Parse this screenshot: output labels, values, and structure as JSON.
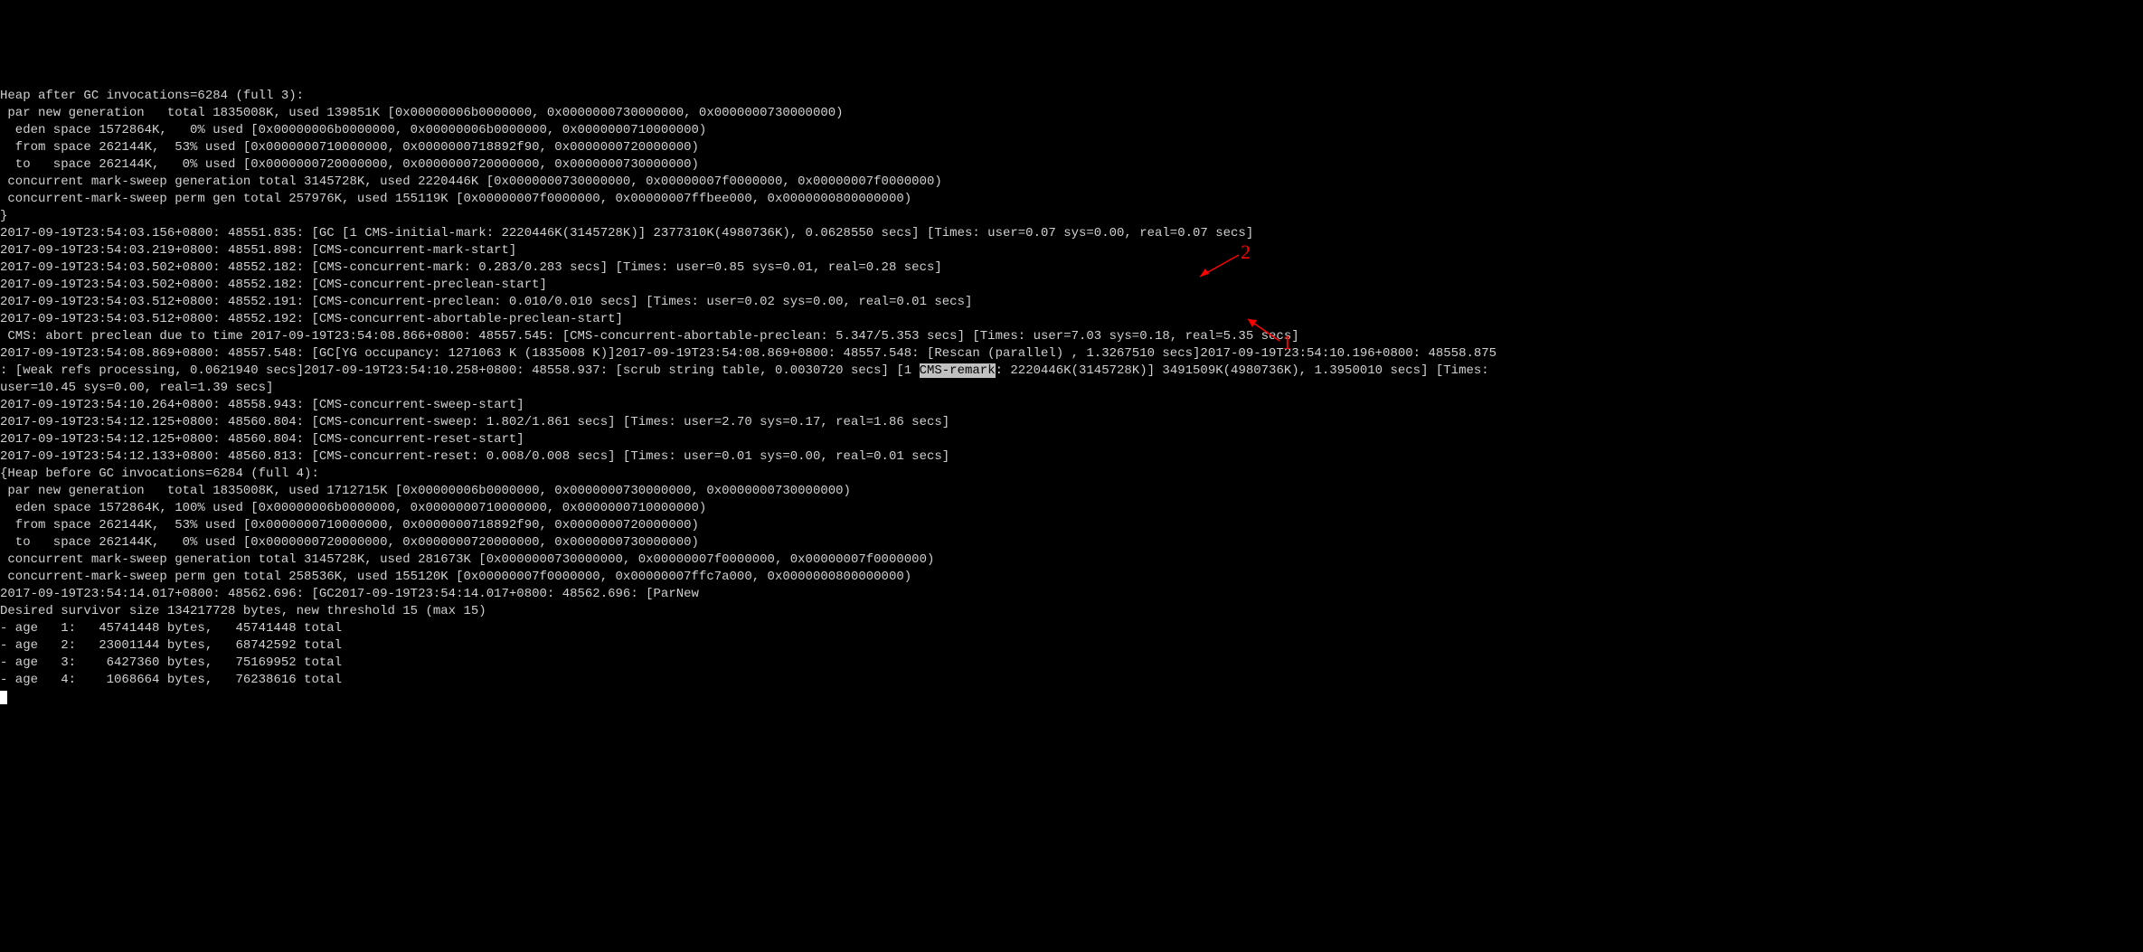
{
  "lines": [
    "Heap after GC invocations=6284 (full 3):",
    " par new generation   total 1835008K, used 139851K [0x00000006b0000000, 0x0000000730000000, 0x0000000730000000)",
    "  eden space 1572864K,   0% used [0x00000006b0000000, 0x00000006b0000000, 0x0000000710000000)",
    "  from space 262144K,  53% used [0x0000000710000000, 0x0000000718892f90, 0x0000000720000000)",
    "  to   space 262144K,   0% used [0x0000000720000000, 0x0000000720000000, 0x0000000730000000)",
    " concurrent mark-sweep generation total 3145728K, used 2220446K [0x0000000730000000, 0x00000007f0000000, 0x00000007f0000000)",
    " concurrent-mark-sweep perm gen total 257976K, used 155119K [0x00000007f0000000, 0x00000007ffbee000, 0x0000000800000000)",
    "}",
    "2017-09-19T23:54:03.156+0800: 48551.835: [GC [1 CMS-initial-mark: 2220446K(3145728K)] 2377310K(4980736K), 0.0628550 secs] [Times: user=0.07 sys=0.00, real=0.07 secs]",
    "2017-09-19T23:54:03.219+0800: 48551.898: [CMS-concurrent-mark-start]",
    "2017-09-19T23:54:03.502+0800: 48552.182: [CMS-concurrent-mark: 0.283/0.283 secs] [Times: user=0.85 sys=0.01, real=0.28 secs]",
    "2017-09-19T23:54:03.502+0800: 48552.182: [CMS-concurrent-preclean-start]",
    "2017-09-19T23:54:03.512+0800: 48552.191: [CMS-concurrent-preclean: 0.010/0.010 secs] [Times: user=0.02 sys=0.00, real=0.01 secs]",
    "2017-09-19T23:54:03.512+0800: 48552.192: [CMS-concurrent-abortable-preclean-start]",
    " CMS: abort preclean due to time 2017-09-19T23:54:08.866+0800: 48557.545: [CMS-concurrent-abortable-preclean: 5.347/5.353 secs] [Times: user=7.03 sys=0.18, real=5.35 secs]"
  ],
  "line16_pre": "2017-09-19T23:54:08.869+0800: 48557.548: [GC[YG occupancy: 1271063 K (1835008 K)]2017-09-19T23:54:08.869+0800: 48557.548: [Rescan (parallel) , 1.3267510 secs]2017-09-19T23:54:10.196+0800: 48558.875",
  "line17_a": ": [weak refs processing, 0.0621940 secs]2017-09-19T23:54:10.258+0800: 48558.937: [scrub string table, 0.0030720 secs] [1 ",
  "line17_hl": "CMS-remark",
  "line17_b": ": 2220446K(3145728K)] 3491509K(4980736K), 1.3950010 secs] [Times:",
  "lines_after": [
    "user=10.45 sys=0.00, real=1.39 secs]",
    "2017-09-19T23:54:10.264+0800: 48558.943: [CMS-concurrent-sweep-start]",
    "2017-09-19T23:54:12.125+0800: 48560.804: [CMS-concurrent-sweep: 1.802/1.861 secs] [Times: user=2.70 sys=0.17, real=1.86 secs]",
    "2017-09-19T23:54:12.125+0800: 48560.804: [CMS-concurrent-reset-start]",
    "2017-09-19T23:54:12.133+0800: 48560.813: [CMS-concurrent-reset: 0.008/0.008 secs] [Times: user=0.01 sys=0.00, real=0.01 secs]",
    "{Heap before GC invocations=6284 (full 4):",
    " par new generation   total 1835008K, used 1712715K [0x00000006b0000000, 0x0000000730000000, 0x0000000730000000)",
    "  eden space 1572864K, 100% used [0x00000006b0000000, 0x0000000710000000, 0x0000000710000000)",
    "  from space 262144K,  53% used [0x0000000710000000, 0x0000000718892f90, 0x0000000720000000)",
    "  to   space 262144K,   0% used [0x0000000720000000, 0x0000000720000000, 0x0000000730000000)",
    " concurrent mark-sweep generation total 3145728K, used 281673K [0x0000000730000000, 0x00000007f0000000, 0x00000007f0000000)",
    " concurrent-mark-sweep perm gen total 258536K, used 155120K [0x00000007f0000000, 0x00000007ffc7a000, 0x0000000800000000)",
    "2017-09-19T23:54:14.017+0800: 48562.696: [GC2017-09-19T23:54:14.017+0800: 48562.696: [ParNew",
    "Desired survivor size 134217728 bytes, new threshold 15 (max 15)",
    "- age   1:   45741448 bytes,   45741448 total",
    "- age   2:   23001144 bytes,   68742592 total",
    "- age   3:    6427360 bytes,   75169952 total",
    "- age   4:    1068664 bytes,   76238616 total"
  ],
  "annot": {
    "label1": "1",
    "label2": "2"
  }
}
